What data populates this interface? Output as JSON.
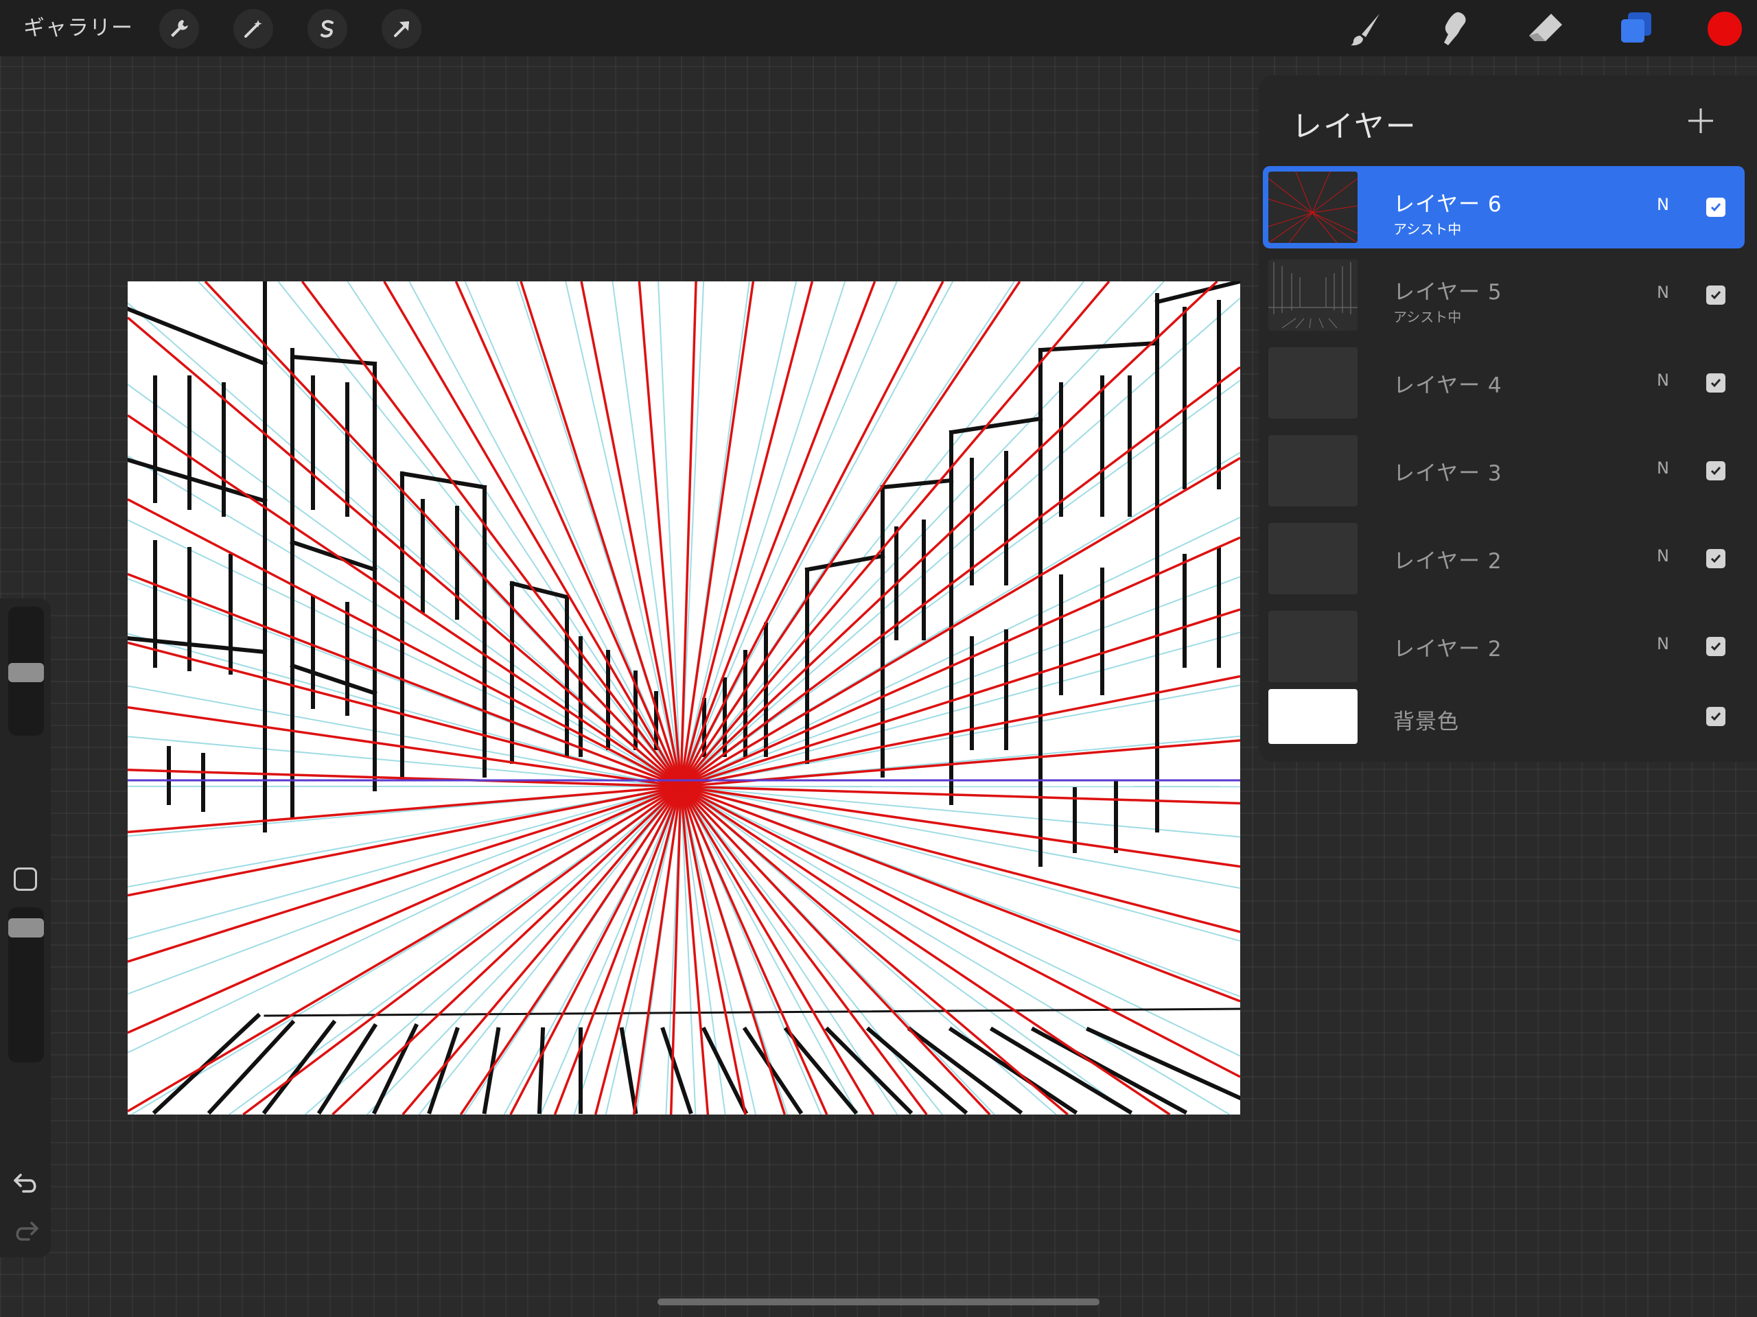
{
  "toolbar": {
    "gallery_label": "ギャラリー",
    "icons": [
      "wrench-icon",
      "magic-wand-icon",
      "selection-icon",
      "transform-arrow-icon"
    ],
    "tools": [
      "brush-icon",
      "smudge-icon",
      "eraser-icon",
      "layers-icon"
    ],
    "current_color": "#e60a0a"
  },
  "layers_panel": {
    "title": "レイヤー",
    "add_icon": "plus-icon",
    "layers": [
      {
        "name": "レイヤー 6",
        "sub": "アシスト中",
        "blend": "N",
        "visible": true,
        "active": true
      },
      {
        "name": "レイヤー 5",
        "sub": "アシスト中",
        "blend": "N",
        "visible": true,
        "active": false
      },
      {
        "name": "レイヤー 4",
        "sub": "",
        "blend": "N",
        "visible": true,
        "active": false
      },
      {
        "name": "レイヤー 3",
        "sub": "",
        "blend": "N",
        "visible": true,
        "active": false
      },
      {
        "name": "レイヤー 2",
        "sub": "",
        "blend": "N",
        "visible": true,
        "active": false
      },
      {
        "name": "レイヤー 2",
        "sub": "",
        "blend": "N",
        "visible": true,
        "active": false
      },
      {
        "name": "背景色",
        "sub": "",
        "blend": "",
        "visible": true,
        "active": false
      }
    ]
  },
  "sidebar": {
    "brush_size_level": 0.49,
    "opacity_level": 0.92,
    "undo_icon": "undo-icon",
    "redo_icon": "redo-icon"
  },
  "colors": {
    "accent": "#3172ec",
    "guide_red": "#dd1111",
    "guide_blue": "#8fd6e0"
  }
}
